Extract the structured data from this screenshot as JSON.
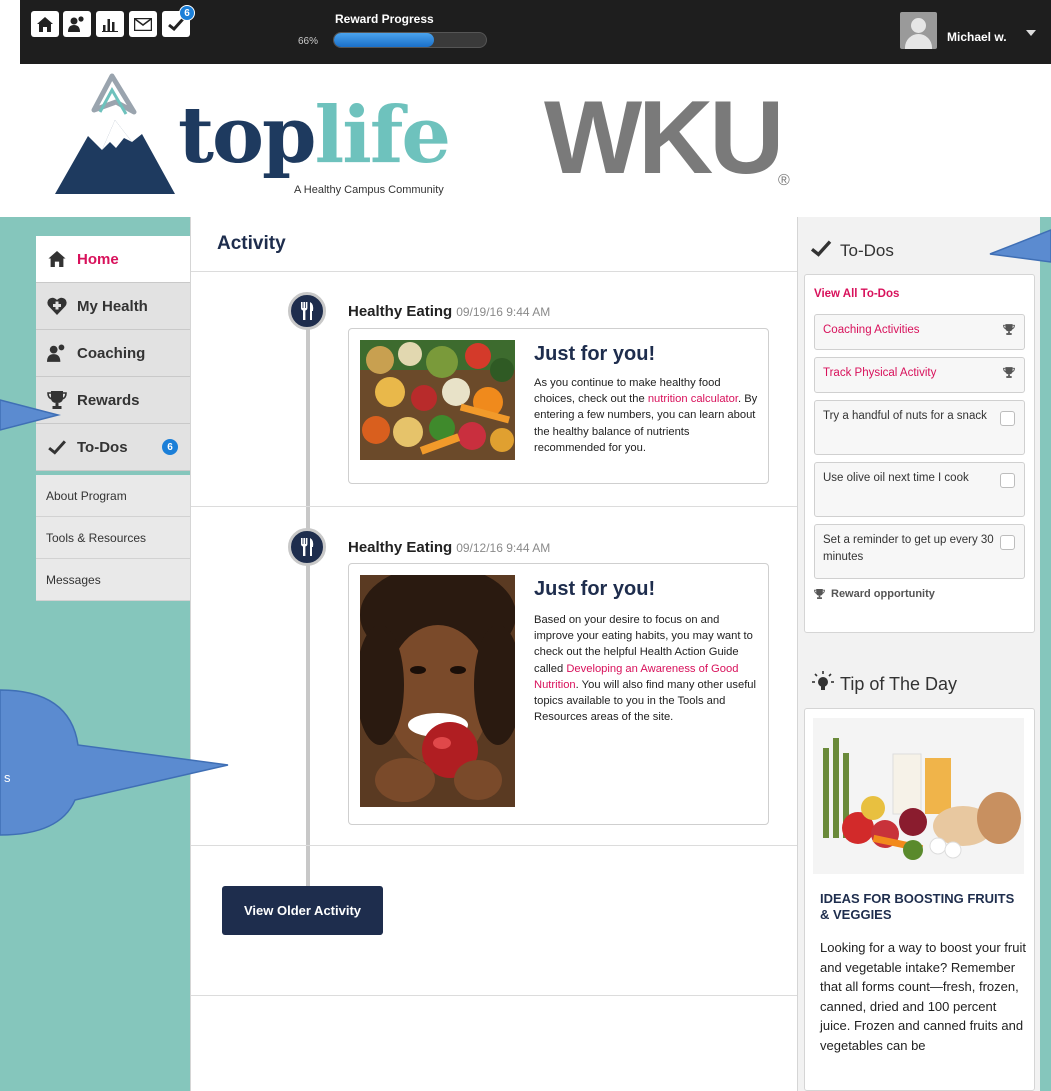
{
  "topbar": {
    "notification_badge": "6",
    "reward_progress_label": "Reward Progress",
    "reward_progress_pct_text": "66%",
    "reward_progress_value": 0.66,
    "username": "Michael w."
  },
  "logo": {
    "word_part1": "top",
    "word_part2": "life",
    "tagline": "A Healthy Campus Community",
    "partner": "WKU",
    "partner_mark": "®"
  },
  "nav": {
    "items": [
      {
        "label": "Home",
        "icon": "home-icon"
      },
      {
        "label": "My Health",
        "icon": "heart-plus-icon"
      },
      {
        "label": "Coaching",
        "icon": "people-icon"
      },
      {
        "label": "Rewards",
        "icon": "trophy-icon"
      },
      {
        "label": "To-Dos",
        "icon": "check-icon",
        "badge": "6"
      }
    ],
    "sub_items": [
      "About Program",
      "Tools & Resources",
      "Messages"
    ]
  },
  "activity": {
    "title": "Activity",
    "entries": [
      {
        "category": "Healthy Eating",
        "date": "09/19/16 9:44 AM",
        "card_title": "Just for you!",
        "body_before": "As you continue to make healthy food choices, check out the ",
        "link": "nutrition calculator",
        "body_after": ". By entering a few numbers, you can learn about the healthy balance of nutrients recommended for you."
      },
      {
        "category": "Healthy Eating",
        "date": "09/12/16 9:44 AM",
        "card_title": "Just for you!",
        "body_before": "Based on your desire to focus on and improve your eating habits, you may want to check out the helpful Health Action Guide called ",
        "link": "Developing an Awareness of Good Nutrition",
        "body_after": ". You will also find many other useful topics available to you in the Tools and Resources areas of the site."
      }
    ],
    "older_button": "View Older Activity"
  },
  "todos": {
    "title": "To-Dos",
    "view_all": "View All To-Dos",
    "items": [
      {
        "label": "Coaching Activities",
        "kind": "reward"
      },
      {
        "label": "Track Physical Activity",
        "kind": "reward"
      },
      {
        "label": "Try a handful of nuts for a snack",
        "kind": "checkbox"
      },
      {
        "label": "Use olive oil next time I cook",
        "kind": "checkbox"
      },
      {
        "label": "Set a reminder to get up every 30 minutes",
        "kind": "checkbox"
      }
    ],
    "reward_note": "Reward opportunity"
  },
  "tip": {
    "title": "Tip of The Day",
    "heading": "IDEAS FOR BOOSTING FRUITS & VEGGIES",
    "body": "Looking for a way to boost your fruit and vegetable intake? Remember that all forms count—fresh, frozen, canned, dried and 100 percent juice. Frozen and canned fruits and vegetables can be"
  },
  "callout": {
    "text": "s"
  },
  "colors": {
    "navy": "#1e2d4d",
    "pink": "#d8115b",
    "teal": "#85c6bc",
    "badge_blue": "#1b7fd8"
  }
}
